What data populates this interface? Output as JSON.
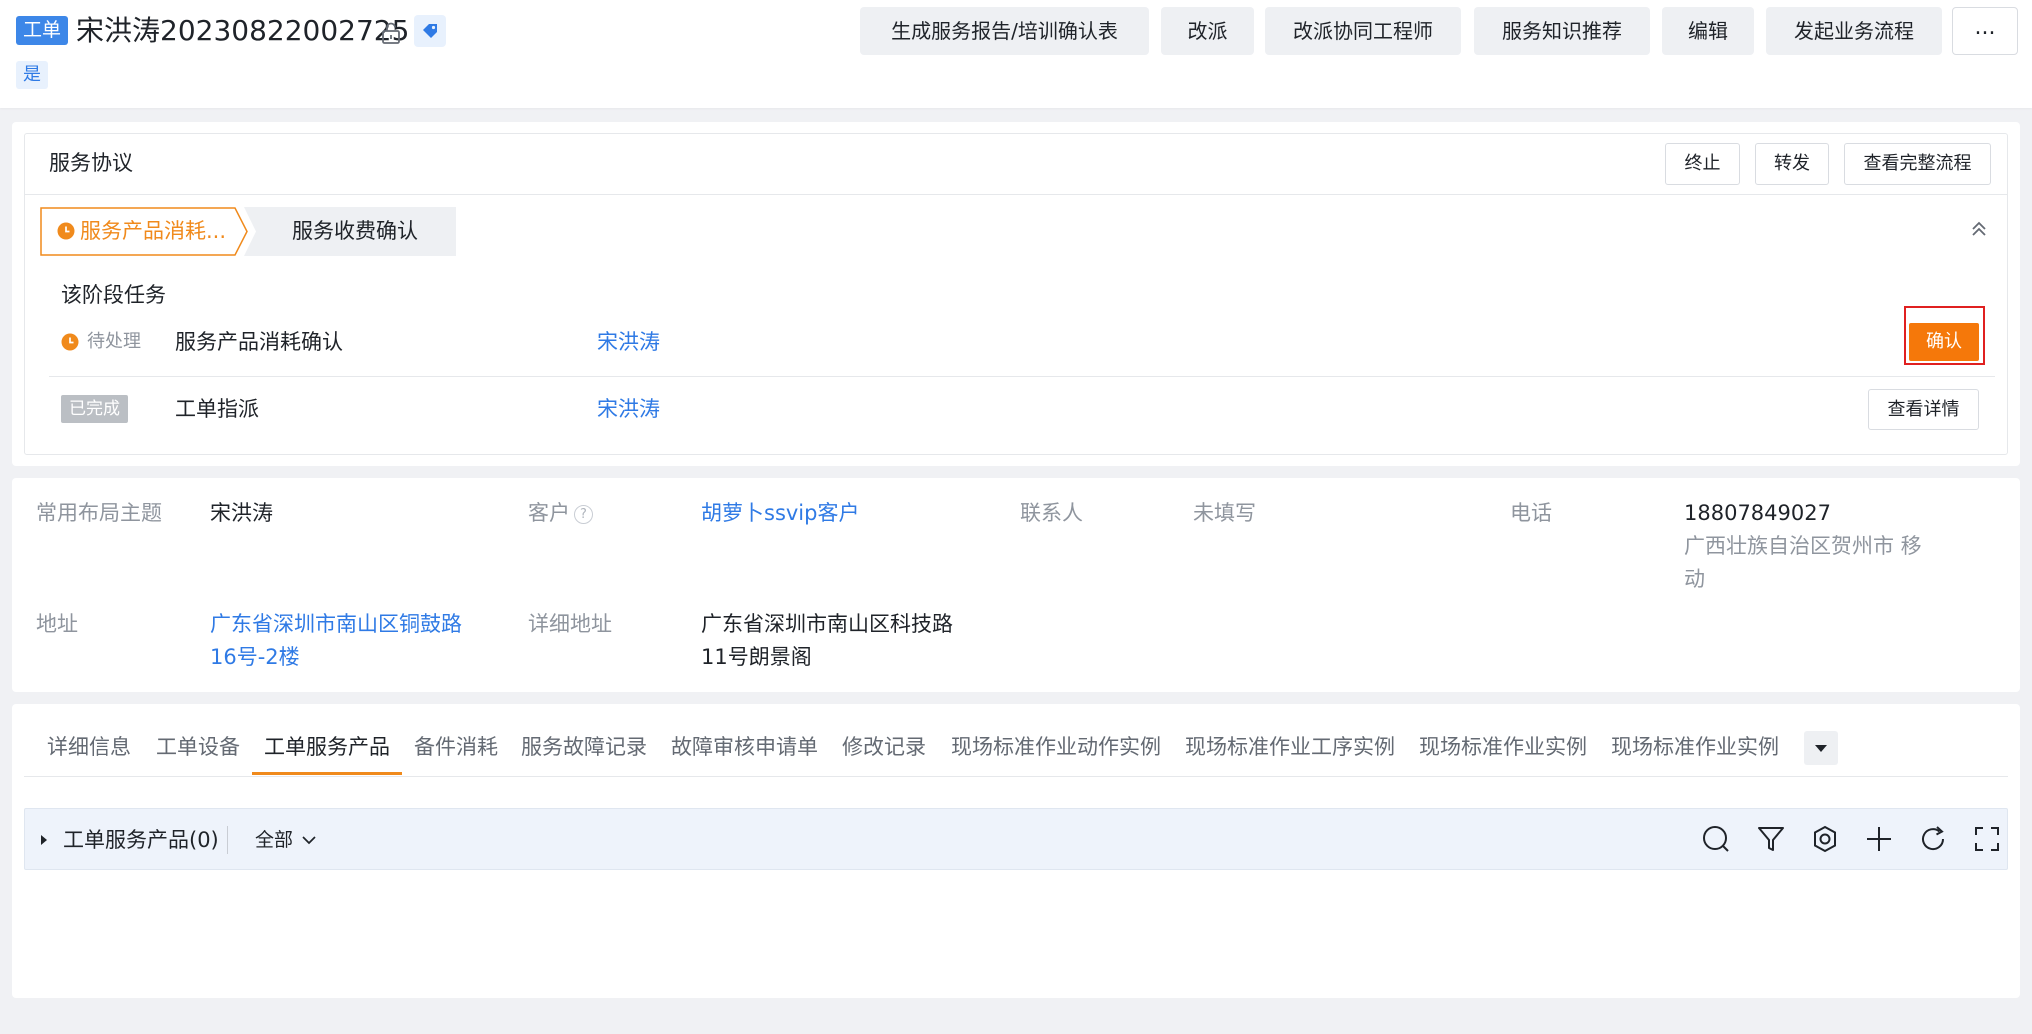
{
  "header": {
    "type_tag": "工单",
    "title": "宋洪涛20230822002725",
    "yes_badge": "是",
    "actions": [
      {
        "label": "生成服务报告/培训确认表"
      },
      {
        "label": "改派"
      },
      {
        "label": "改派协同工程师"
      },
      {
        "label": "服务知识推荐"
      },
      {
        "label": "编辑"
      },
      {
        "label": "发起业务流程"
      }
    ],
    "more_label": "..."
  },
  "agreement": {
    "title": "服务协议",
    "buttons": {
      "terminate": "终止",
      "forward": "转发",
      "view_flow": "查看完整流程"
    },
    "steps": [
      {
        "label": "服务产品消耗..."
      },
      {
        "label": "服务收费确认"
      }
    ],
    "stage_title": "该阶段任务",
    "tasks": [
      {
        "status": "待处理",
        "name": "服务产品消耗确认",
        "user": "宋洪涛",
        "action": "确认"
      },
      {
        "status": "已完成",
        "name": "工单指派",
        "user": "宋洪涛",
        "action": "查看详情"
      }
    ]
  },
  "info": {
    "layout_label": "常用布局主题",
    "layout_value": "宋洪涛",
    "customer_label": "客户",
    "customer_help": "?",
    "customer_value": "胡萝卜ssvip客户",
    "contact_label": "联系人",
    "contact_value": "未填写",
    "phone_label": "电话",
    "phone_value": "18807849027",
    "phone_location": "广西壮族自治区贺州市 移动",
    "address_label": "地址",
    "address_value": "广东省深圳市南山区铜鼓路16号-2楼",
    "detail_address_label": "详细地址",
    "detail_address_value": "广东省深圳市南山区科技路11号朗景阁"
  },
  "tabs": [
    {
      "label": "详细信息"
    },
    {
      "label": "工单设备"
    },
    {
      "label": "工单服务产品"
    },
    {
      "label": "备件消耗"
    },
    {
      "label": "服务故障记录"
    },
    {
      "label": "故障审核申请单"
    },
    {
      "label": "修改记录"
    },
    {
      "label": "现场标准作业动作实例"
    },
    {
      "label": "现场标准作业工序实例"
    },
    {
      "label": "现场标准作业实例"
    },
    {
      "label": "现场标准作业实例"
    }
  ],
  "active_tab": "工单服务产品",
  "subpanel": {
    "title": "工单服务产品(0)",
    "filter": "全部",
    "tools": [
      "search-icon",
      "filter-icon",
      "settings-icon",
      "plus-icon",
      "refresh-icon",
      "fullscreen-icon"
    ]
  },
  "colors": {
    "accent_orange": "#f5780a",
    "link_blue": "#2f7ae5",
    "tag_blue": "#3d87e8"
  }
}
